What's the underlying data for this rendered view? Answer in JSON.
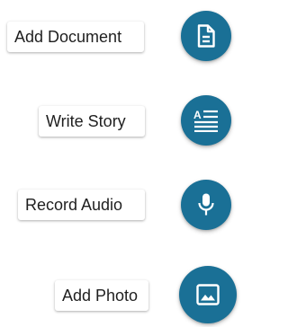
{
  "accent_color": "#1a7096",
  "actions": [
    {
      "label": "Add Document",
      "icon": "document-icon"
    },
    {
      "label": "Write Story",
      "icon": "story-text-icon"
    },
    {
      "label": "Record Audio",
      "icon": "microphone-icon"
    },
    {
      "label": "Add Photo",
      "icon": "photo-icon"
    }
  ]
}
